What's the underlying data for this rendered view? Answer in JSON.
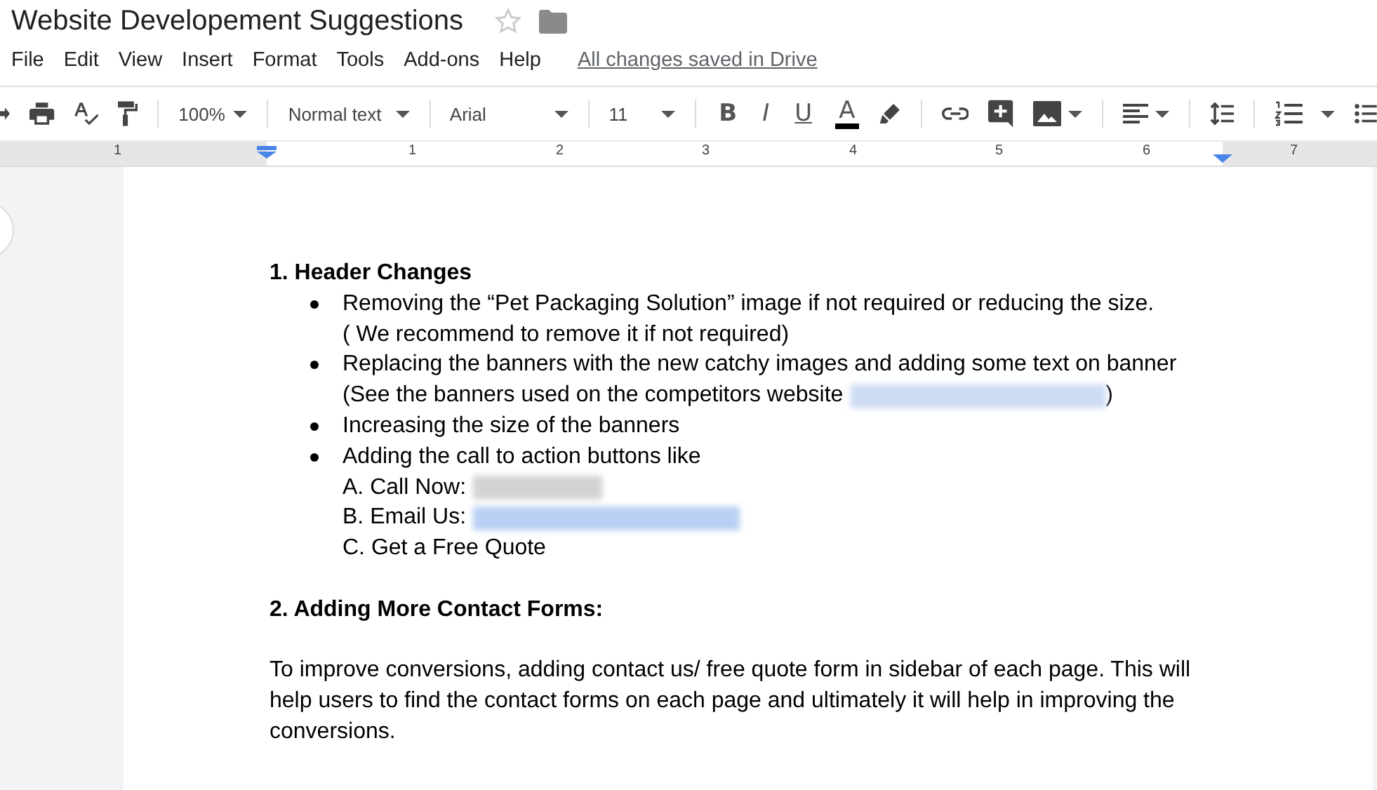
{
  "document_title": {
    "text": "Website Developement Suggestions",
    "starred": false
  },
  "menu": [
    "File",
    "Edit",
    "View",
    "Insert",
    "Format",
    "Tools",
    "Add-ons",
    "Help"
  ],
  "save_status": "All changes saved in Drive",
  "toolbar": {
    "zoom": "100%",
    "style": "Normal text",
    "font": "Arial",
    "size": "11",
    "bold": "B",
    "italic": "I",
    "underline": "U",
    "text_color": "A"
  },
  "ruler": {
    "labels": [
      "1",
      "1",
      "2",
      "3",
      "4",
      "5",
      "6",
      "7"
    ]
  },
  "blocks": [
    {
      "kind": "heading",
      "lines": [
        {
          "text": "1. Header Changes"
        }
      ]
    },
    {
      "kind": "bullet",
      "lines": [
        {
          "kind": "plain",
          "text": "Removing the “Pet Packaging Solution” image if not required or reducing the size."
        },
        {
          "kind": "plain",
          "text": "( We recommend to remove it if not required)"
        }
      ]
    },
    {
      "kind": "bullet",
      "lines": [
        {
          "kind": "plain",
          "text": "Replacing the banners with the new catchy images and adding some text on banner"
        },
        {
          "kind": "link",
          "text": "(See the banners used on the competitors website",
          "after": ")"
        }
      ]
    },
    {
      "kind": "bullet",
      "lines": [
        {
          "kind": "plain",
          "text": "Increasing the size of the banners"
        }
      ]
    },
    {
      "kind": "bullet",
      "lines": [
        {
          "kind": "plain",
          "text": "Adding the call to action buttons like"
        },
        {
          "kind": "phone",
          "text": "A. Call Now:"
        },
        {
          "kind": "email",
          "text": "B. Email Us:"
        },
        {
          "kind": "plain",
          "text": "C. Get a Free Quote"
        }
      ]
    },
    {
      "kind": "blank"
    },
    {
      "kind": "heading",
      "lines": [
        {
          "text": "2. Adding More Contact Forms:"
        }
      ]
    },
    {
      "kind": "blank"
    },
    {
      "kind": "paragraph",
      "lines": [
        {
          "text": "To improve conversions, adding contact us/ free quote form in sidebar of each page. This will help users to find the contact forms on each page and ultimately it will help in improving the conversions."
        }
      ]
    }
  ]
}
